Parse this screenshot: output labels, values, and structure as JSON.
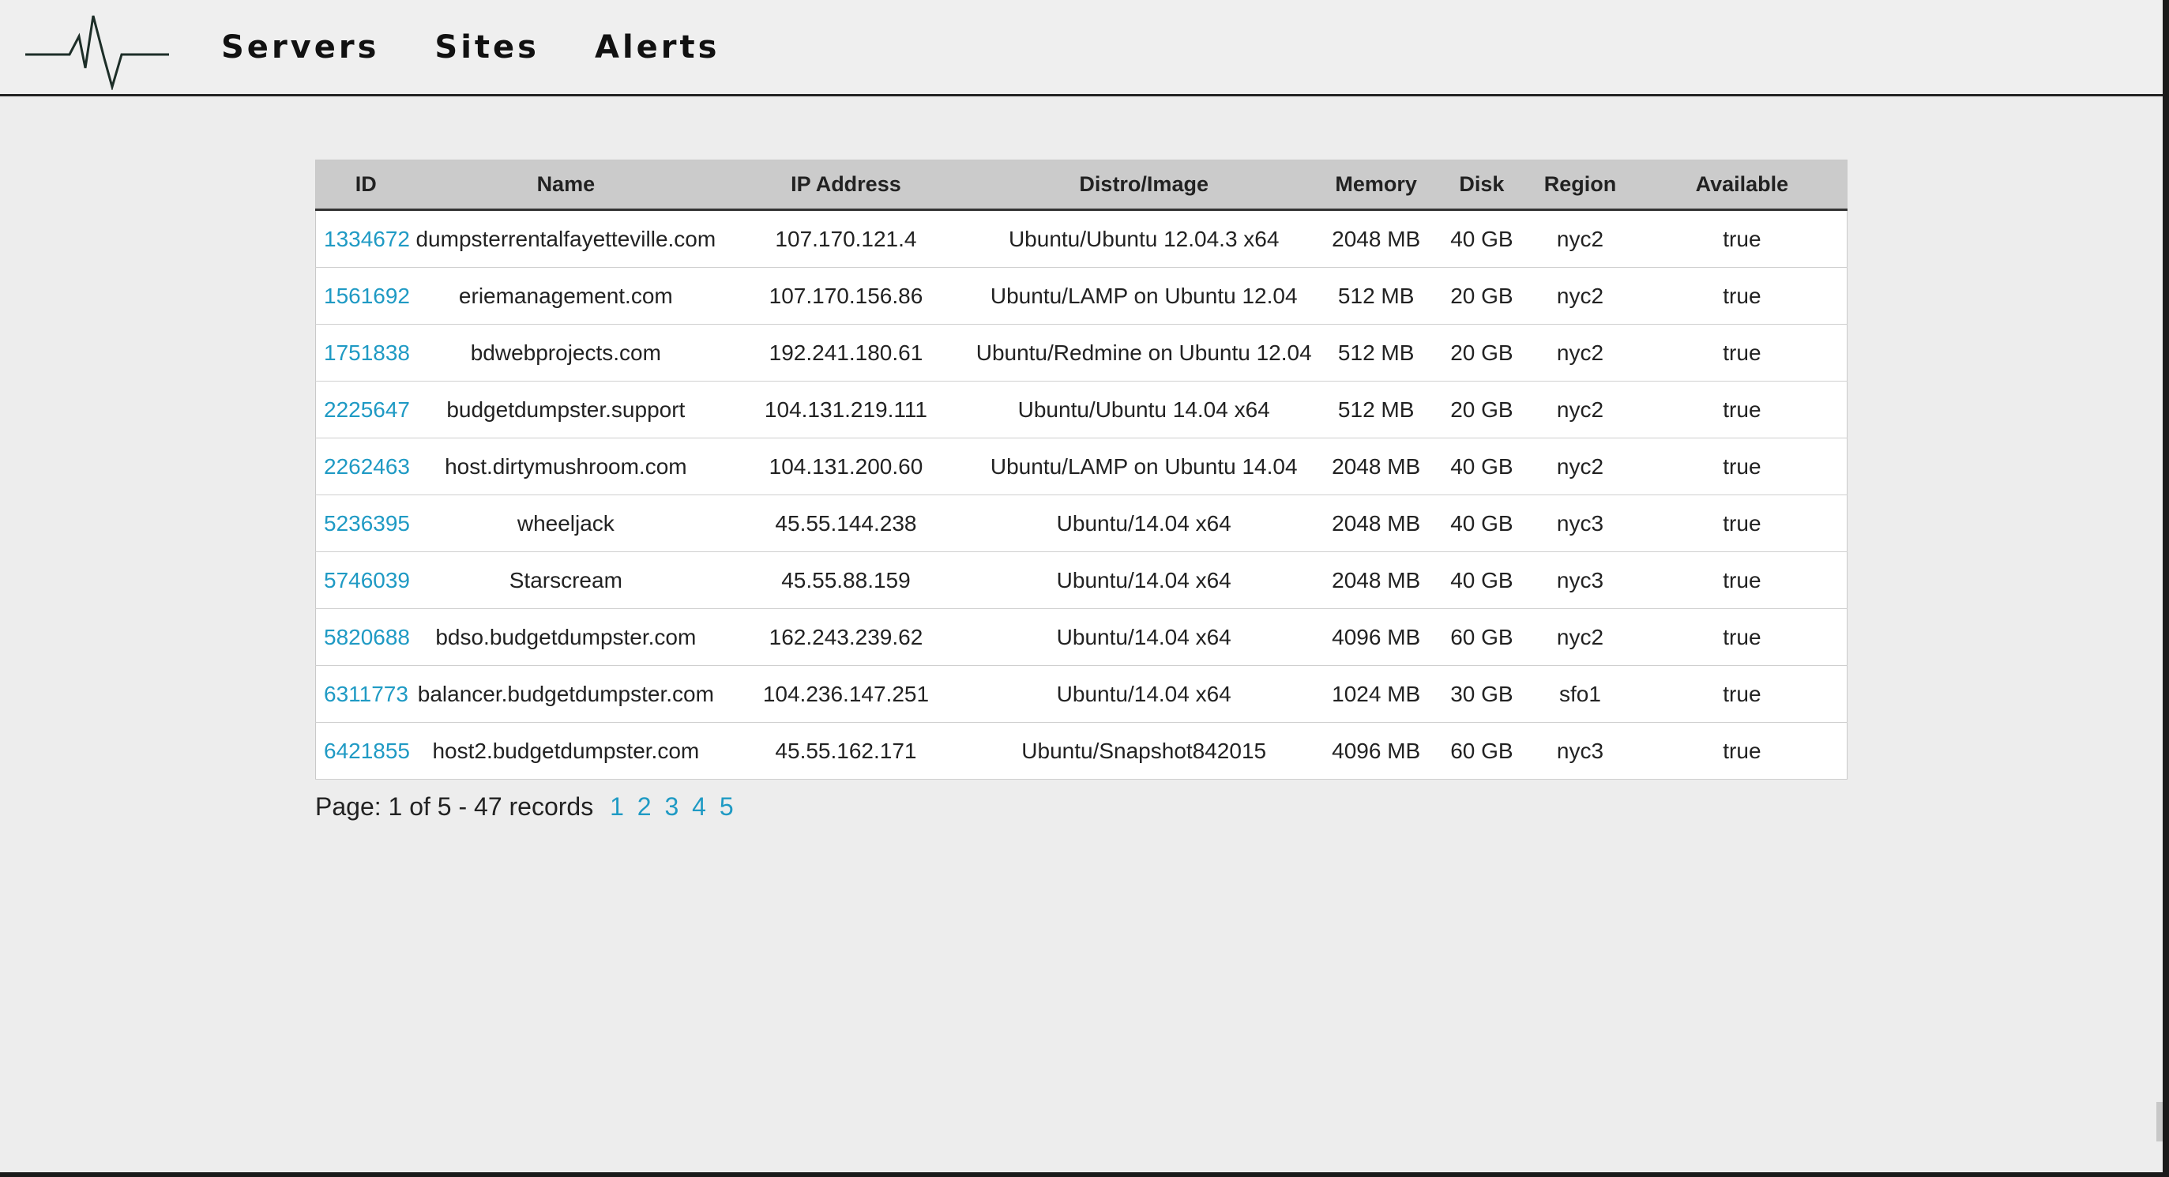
{
  "nav": {
    "items": [
      "Servers",
      "Sites",
      "Alerts"
    ]
  },
  "table": {
    "headers": [
      "ID",
      "Name",
      "IP Address",
      "Distro/Image",
      "Memory",
      "Disk",
      "Region",
      "Available"
    ],
    "rows": [
      {
        "id": "1334672",
        "name": "dumpsterrentalfayetteville.com",
        "ip": "107.170.121.4",
        "distro": "Ubuntu/Ubuntu 12.04.3 x64",
        "memory": "2048 MB",
        "disk": "40 GB",
        "region": "nyc2",
        "available": "true"
      },
      {
        "id": "1561692",
        "name": "eriemanagement.com",
        "ip": "107.170.156.86",
        "distro": "Ubuntu/LAMP on Ubuntu 12.04",
        "memory": "512 MB",
        "disk": "20 GB",
        "region": "nyc2",
        "available": "true"
      },
      {
        "id": "1751838",
        "name": "bdwebprojects.com",
        "ip": "192.241.180.61",
        "distro": "Ubuntu/Redmine on Ubuntu 12.04",
        "memory": "512 MB",
        "disk": "20 GB",
        "region": "nyc2",
        "available": "true"
      },
      {
        "id": "2225647",
        "name": "budgetdumpster.support",
        "ip": "104.131.219.111",
        "distro": "Ubuntu/Ubuntu 14.04 x64",
        "memory": "512 MB",
        "disk": "20 GB",
        "region": "nyc2",
        "available": "true"
      },
      {
        "id": "2262463",
        "name": "host.dirtymushroom.com",
        "ip": "104.131.200.60",
        "distro": "Ubuntu/LAMP on Ubuntu 14.04",
        "memory": "2048 MB",
        "disk": "40 GB",
        "region": "nyc2",
        "available": "true"
      },
      {
        "id": "5236395",
        "name": "wheeljack",
        "ip": "45.55.144.238",
        "distro": "Ubuntu/14.04 x64",
        "memory": "2048 MB",
        "disk": "40 GB",
        "region": "nyc3",
        "available": "true"
      },
      {
        "id": "5746039",
        "name": "Starscream",
        "ip": "45.55.88.159",
        "distro": "Ubuntu/14.04 x64",
        "memory": "2048 MB",
        "disk": "40 GB",
        "region": "nyc3",
        "available": "true"
      },
      {
        "id": "5820688",
        "name": "bdso.budgetdumpster.com",
        "ip": "162.243.239.62",
        "distro": "Ubuntu/14.04 x64",
        "memory": "4096 MB",
        "disk": "60 GB",
        "region": "nyc2",
        "available": "true"
      },
      {
        "id": "6311773",
        "name": "balancer.budgetdumpster.com",
        "ip": "104.236.147.251",
        "distro": "Ubuntu/14.04 x64",
        "memory": "1024 MB",
        "disk": "30 GB",
        "region": "sfo1",
        "available": "true"
      },
      {
        "id": "6421855",
        "name": "host2.budgetdumpster.com",
        "ip": "45.55.162.171",
        "distro": "Ubuntu/Snapshot842015",
        "memory": "4096 MB",
        "disk": "60 GB",
        "region": "nyc3",
        "available": "true"
      }
    ]
  },
  "pager": {
    "summary": "Page: 1 of 5 - 47 records",
    "pages": [
      "1",
      "2",
      "3",
      "4",
      "5"
    ]
  },
  "colors": {
    "link": "#1f9ac4",
    "header_bg": "#cbcbcb",
    "page_bg": "#ededed"
  },
  "icons": {
    "logo": "heartbeat-pulse-icon"
  }
}
